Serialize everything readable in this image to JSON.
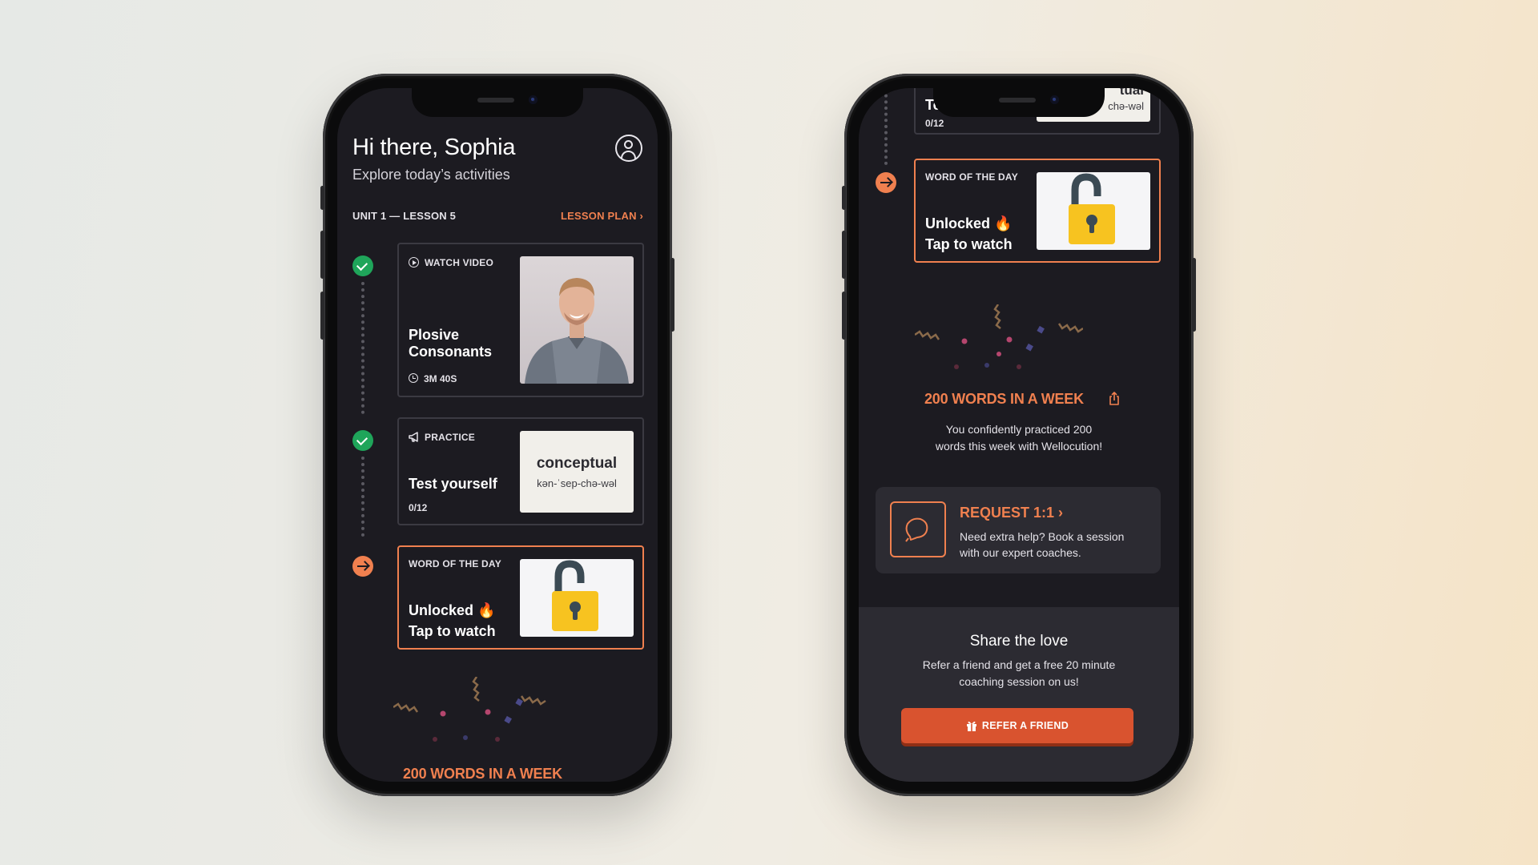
{
  "left": {
    "greeting": "Hi there, Sophia",
    "subtitle": "Explore today’s activities",
    "unit_label": "UNIT 1 — LESSON 5",
    "lesson_plan_label": "LESSON PLAN ›",
    "activities": [
      {
        "tag": "WATCH VIDEO",
        "title_line1": "Plosive",
        "title_line2": "Consonants",
        "meta": "3M 40S",
        "status": "complete"
      },
      {
        "tag": "PRACTICE",
        "title": "Test yourself",
        "meta": "0/12",
        "flash_word": "conceptual",
        "flash_phonetic": "kən-ˈsep-chə-wəl",
        "status": "complete"
      },
      {
        "tag": "WORD OF THE DAY",
        "title_line1": "Unlocked 🔥",
        "title_line2": "Tap to watch",
        "status": "current"
      }
    ],
    "peek_title": "200 WORDS IN A WEEK"
  },
  "right": {
    "top_partial_title": "Te",
    "top_partial_meta": "0/12",
    "top_partial_word": "tual",
    "top_partial_phonetic": "chə-wəl",
    "wotd": {
      "tag": "WORD OF THE DAY",
      "title_line1": "Unlocked 🔥",
      "title_line2": "Tap to watch"
    },
    "achievement": {
      "title": "200 WORDS IN A WEEK",
      "desc_line1": "You confidently practiced 200",
      "desc_line2": "words this week with Wellocution!"
    },
    "request": {
      "title": "REQUEST 1:1 ›",
      "desc_line1": "Need extra help? Book a session",
      "desc_line2": "with our expert coaches."
    },
    "share": {
      "title": "Share the love",
      "desc_line1": "Refer a friend and get a free 20 minute",
      "desc_line2": "coaching session on us!",
      "button_label": "REFER A FRIEND"
    }
  },
  "colors": {
    "screen_bg": "#1c1b21",
    "accent": "#f0804f",
    "success": "#1fa55a",
    "button": "#d9532f",
    "lock_yellow": "#f7c320",
    "lock_shackle": "#3b4a54"
  },
  "icons": [
    "profile-icon",
    "play-icon",
    "clock-icon",
    "megaphone-icon",
    "lock-open-icon",
    "chat-bubble-icon",
    "gift-icon",
    "share-icon",
    "check-icon",
    "arrow-right-icon"
  ]
}
